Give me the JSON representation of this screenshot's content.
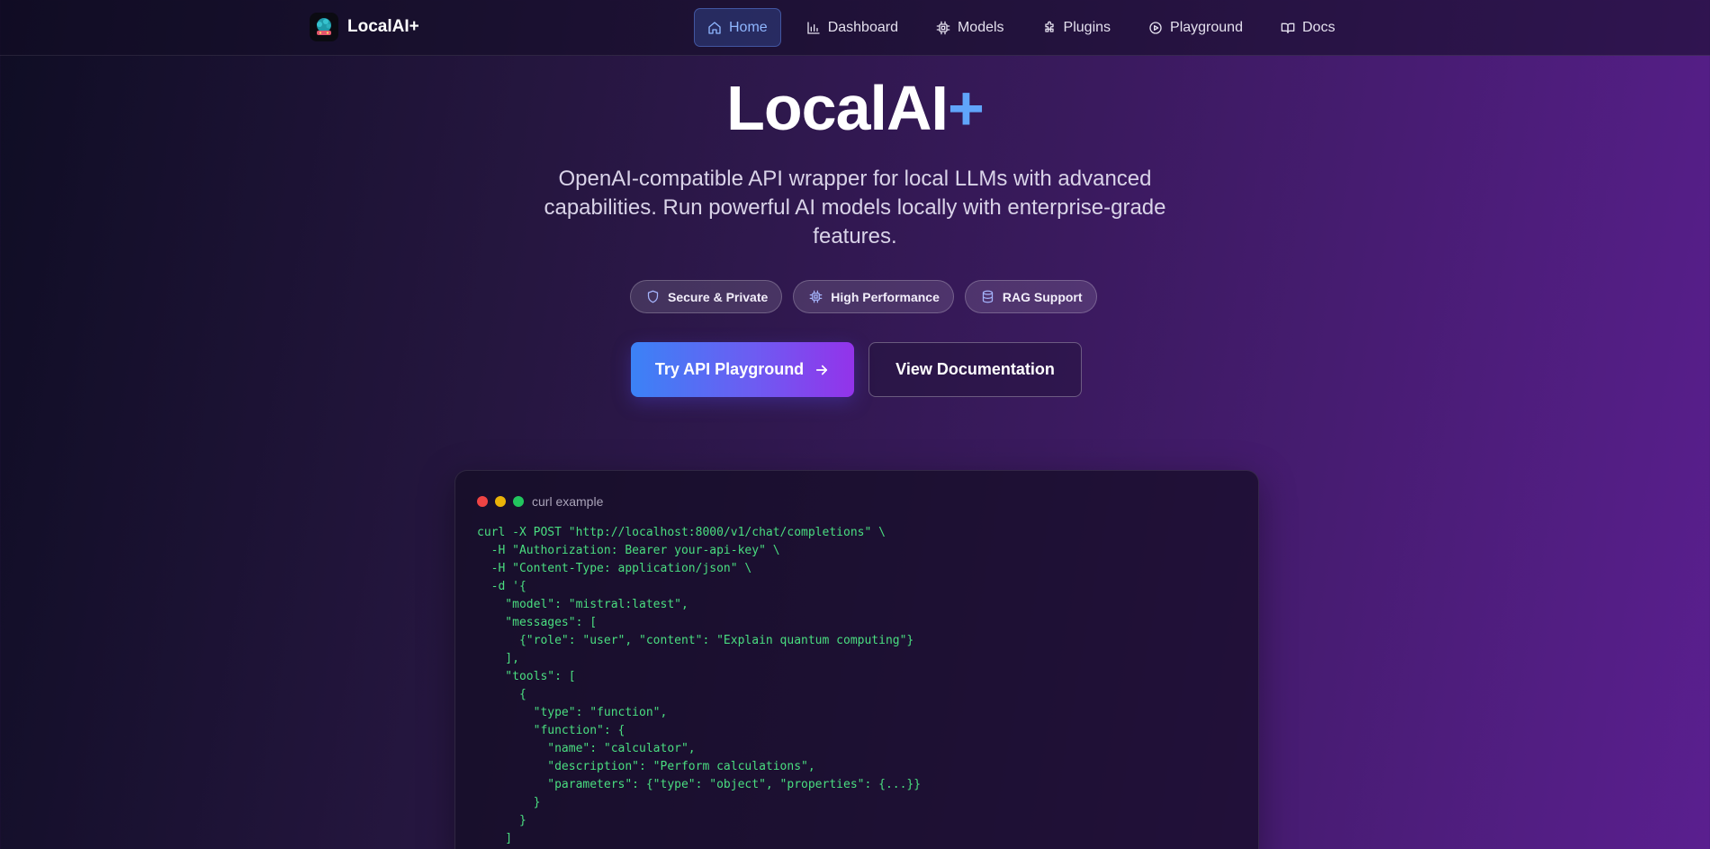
{
  "brand": {
    "name": "LocalAI+"
  },
  "nav": {
    "items": [
      {
        "label": "Home",
        "icon": "home-icon",
        "active": true
      },
      {
        "label": "Dashboard",
        "icon": "bar-chart-icon",
        "active": false
      },
      {
        "label": "Models",
        "icon": "cpu-icon",
        "active": false
      },
      {
        "label": "Plugins",
        "icon": "puzzle-icon",
        "active": false
      },
      {
        "label": "Playground",
        "icon": "play-circle-icon",
        "active": false
      },
      {
        "label": "Docs",
        "icon": "book-icon",
        "active": false
      }
    ]
  },
  "hero": {
    "title_main": "LocalAI",
    "title_plus": "+",
    "subtitle": "OpenAI-compatible API wrapper for local LLMs with advanced capabilities. Run powerful AI models locally with enterprise-grade features.",
    "badges": [
      {
        "label": "Secure & Private",
        "icon": "shield-icon"
      },
      {
        "label": "High Performance",
        "icon": "cpu-icon"
      },
      {
        "label": "RAG Support",
        "icon": "database-icon"
      }
    ],
    "primary_button": "Try API Playground",
    "secondary_button": "View Documentation"
  },
  "code_example": {
    "label": "curl example",
    "window_dots": [
      "#ef4444",
      "#eab308",
      "#22c55e"
    ],
    "lines": [
      "curl -X POST \"http://localhost:8000/v1/chat/completions\" \\",
      "  -H \"Authorization: Bearer your-api-key\" \\",
      "  -H \"Content-Type: application/json\" \\",
      "  -d '{",
      "    \"model\": \"mistral:latest\",",
      "    \"messages\": [",
      "      {\"role\": \"user\", \"content\": \"Explain quantum computing\"}",
      "    ],",
      "    \"tools\": [",
      "      {",
      "        \"type\": \"function\",",
      "        \"function\": {",
      "          \"name\": \"calculator\",",
      "          \"description\": \"Perform calculations\",",
      "          \"parameters\": {\"type\": \"object\", \"properties\": {...}}",
      "        }",
      "      }",
      "    ]"
    ]
  },
  "colors": {
    "accent_blue": "#60a5fa",
    "code_green": "#4ade80",
    "gradient_start": "#3b82f6",
    "gradient_end": "#9333ea"
  }
}
